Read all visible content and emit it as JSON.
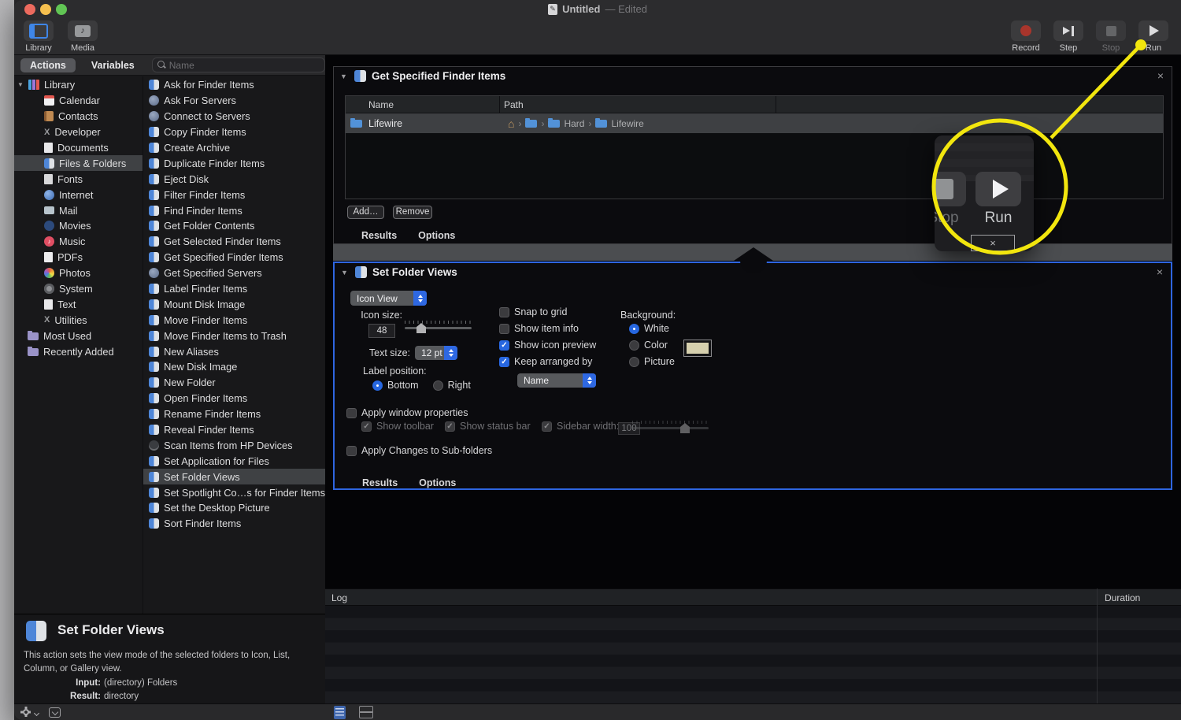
{
  "ui": {
    "disclosure": "▼",
    "close": "×"
  },
  "titlebar": {
    "title": "Untitled",
    "edited": "— Edited"
  },
  "toolbar": {
    "left": [
      {
        "label": "Library",
        "icon": "library"
      },
      {
        "label": "Media",
        "icon": "media"
      }
    ],
    "right": [
      {
        "label": "Record",
        "icon": "record"
      },
      {
        "label": "Step",
        "icon": "step"
      },
      {
        "label": "Stop",
        "icon": "stop",
        "cls": "dim"
      },
      {
        "label": "Run",
        "icon": "run"
      }
    ]
  },
  "sidebar": {
    "tab_actions": "Actions",
    "tab_variables": "Variables",
    "search_placeholder": "Name",
    "categories": [
      {
        "label": "Library",
        "icon": "libbooks",
        "cls": "root"
      },
      {
        "label": "Calendar",
        "icon": "calendar",
        "cls": "child"
      },
      {
        "label": "Contacts",
        "icon": "contacts",
        "cls": "child"
      },
      {
        "label": "Developer",
        "icon": "developer",
        "cls": "child"
      },
      {
        "label": "Documents",
        "icon": "documents",
        "cls": "child"
      },
      {
        "label": "Files & Folders",
        "icon": "finder",
        "cls": "child",
        "selected": true
      },
      {
        "label": "Fonts",
        "icon": "fonts",
        "cls": "child"
      },
      {
        "label": "Internet",
        "icon": "internet",
        "cls": "child"
      },
      {
        "label": "Mail",
        "icon": "mail",
        "cls": "child"
      },
      {
        "label": "Movies",
        "icon": "movies",
        "cls": "child"
      },
      {
        "label": "Music",
        "icon": "music",
        "cls": "child"
      },
      {
        "label": "PDFs",
        "icon": "pdfs",
        "cls": "child"
      },
      {
        "label": "Photos",
        "icon": "photos",
        "cls": "child"
      },
      {
        "label": "System",
        "icon": "system",
        "cls": "child"
      },
      {
        "label": "Text",
        "icon": "text",
        "cls": "child"
      },
      {
        "label": "Utilities",
        "icon": "utilities",
        "cls": "child"
      },
      {
        "label": "Most Used",
        "icon": "folder",
        "cls": "group"
      },
      {
        "label": "Recently Added",
        "icon": "folder",
        "cls": "group"
      }
    ],
    "actions": [
      {
        "label": "Ask for Finder Items",
        "icon": "finder"
      },
      {
        "label": "Ask For Servers",
        "icon": "globe"
      },
      {
        "label": "Connect to Servers",
        "icon": "globe"
      },
      {
        "label": "Copy Finder Items",
        "icon": "finder"
      },
      {
        "label": "Create Archive",
        "icon": "finder"
      },
      {
        "label": "Duplicate Finder Items",
        "icon": "finder"
      },
      {
        "label": "Eject Disk",
        "icon": "finder"
      },
      {
        "label": "Filter Finder Items",
        "icon": "finder"
      },
      {
        "label": "Find Finder Items",
        "icon": "finder"
      },
      {
        "label": "Get Folder Contents",
        "icon": "finder"
      },
      {
        "label": "Get Selected Finder Items",
        "icon": "finder"
      },
      {
        "label": "Get Specified Finder Items",
        "icon": "finder"
      },
      {
        "label": "Get Specified Servers",
        "icon": "globe"
      },
      {
        "label": "Label Finder Items",
        "icon": "finder"
      },
      {
        "label": "Mount Disk Image",
        "icon": "finder"
      },
      {
        "label": "Move Finder Items",
        "icon": "finder"
      },
      {
        "label": "Move Finder Items to Trash",
        "icon": "finder"
      },
      {
        "label": "New Aliases",
        "icon": "finder"
      },
      {
        "label": "New Disk Image",
        "icon": "finder"
      },
      {
        "label": "New Folder",
        "icon": "finder"
      },
      {
        "label": "Open Finder Items",
        "icon": "finder"
      },
      {
        "label": "Rename Finder Items",
        "icon": "finder"
      },
      {
        "label": "Reveal Finder Items",
        "icon": "finder"
      },
      {
        "label": "Scan Items from HP Devices",
        "icon": "scanner"
      },
      {
        "label": "Set Application for Files",
        "icon": "finder"
      },
      {
        "label": "Set Folder Views",
        "icon": "finder",
        "selected": true
      },
      {
        "label": "Set Spotlight Co…s for Finder Items",
        "icon": "finder"
      },
      {
        "label": "Set the Desktop Picture",
        "icon": "finder"
      },
      {
        "label": "Sort Finder Items",
        "icon": "finder"
      }
    ]
  },
  "workflow": {
    "block1": {
      "title": "Get Specified Finder Items",
      "col_name": "Name",
      "col_path": "Path",
      "row_name": "Lifewire",
      "path": [
        {
          "icon": "home",
          "sep": ""
        },
        {
          "icon": "bfolder",
          "sep": "›"
        },
        {
          "icon": "bfolder",
          "label": "Hard",
          "sep": "›"
        },
        {
          "icon": "bfolder",
          "label": "Lifewire",
          "sep": "›"
        }
      ],
      "add_label": "Add…",
      "remove_label": "Remove",
      "results_label": "Results",
      "options_label": "Options"
    },
    "block2": {
      "title": "Set Folder Views",
      "view_popup": "Icon View",
      "icon_size_label": "Icon size:",
      "icon_size": "48",
      "text_size_label": "Text size:",
      "text_size": "12 pt",
      "label_position_label": "Label position:",
      "position_options": [
        {
          "label": "Bottom",
          "selected": true
        },
        {
          "label": "Right"
        }
      ],
      "view_checks": [
        {
          "label": "Snap to grid",
          "checked": false
        },
        {
          "label": "Show item info",
          "checked": false
        },
        {
          "label": "Show icon preview",
          "checked": true
        },
        {
          "label": "Keep arranged by",
          "checked": true
        }
      ],
      "keep_popup": "Name",
      "background_label": "Background:",
      "background_options": [
        {
          "label": "White",
          "selected": true
        },
        {
          "label": "Color"
        },
        {
          "label": "Picture"
        }
      ],
      "apply_window_label": "Apply window properties",
      "window_props": [
        {
          "label": "Show toolbar",
          "checked": true,
          "cls": "dim"
        },
        {
          "label": "Show status bar",
          "checked": true,
          "cls": "dim"
        },
        {
          "label": "Sidebar width:",
          "checked": true,
          "cls": "dim"
        }
      ],
      "sidebar_width": "100",
      "apply_changes_label": "Apply Changes to Sub-folders",
      "results_label": "Results",
      "options_label": "Options"
    }
  },
  "log": {
    "log_header": "Log",
    "duration_header": "Duration"
  },
  "description": {
    "title": "Set Folder Views",
    "text": "This action sets the view mode of the selected folders to Icon, List, Column, or Gallery view.",
    "input_label": "Input:",
    "input_value": "(directory) Folders",
    "result_label": "Result:",
    "result_value": "directory"
  },
  "callout": {
    "stop_label": "Stop",
    "run_label": "Run",
    "accent": "#f2e60e"
  }
}
